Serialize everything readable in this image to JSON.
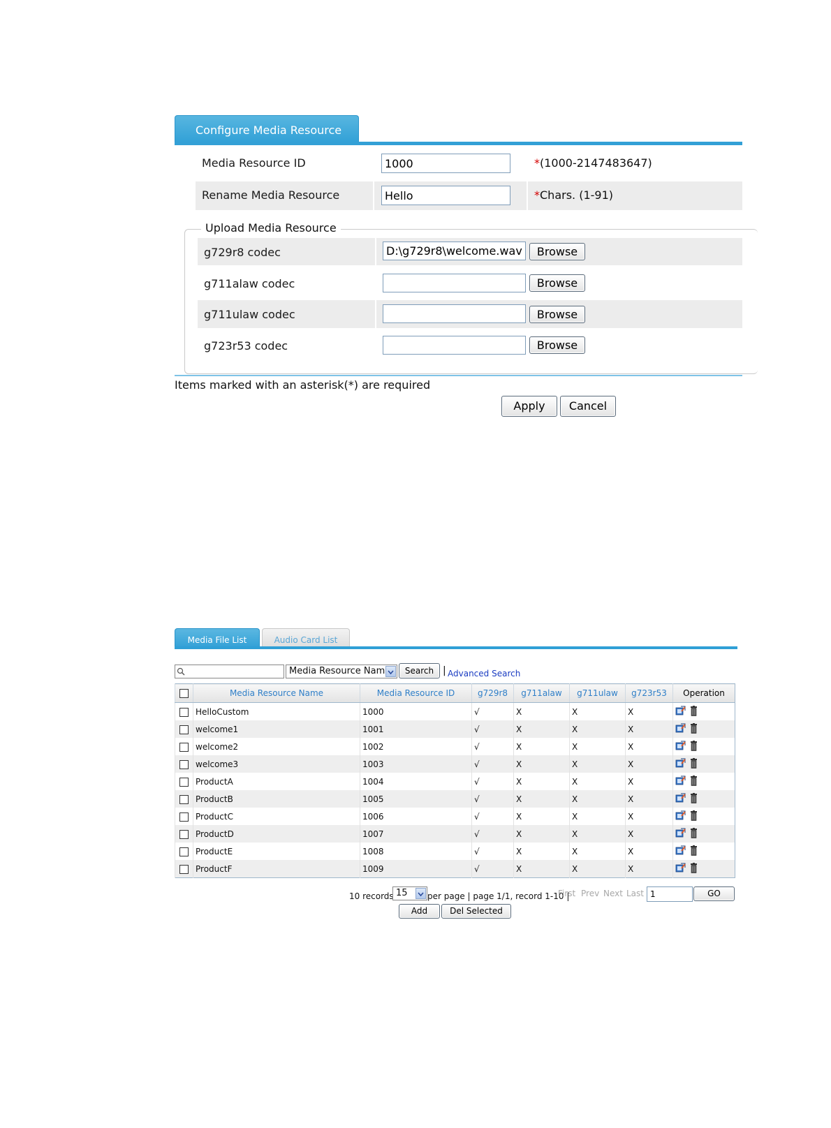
{
  "config": {
    "tab_label": "Configure Media Resource",
    "id_label": "Media Resource ID",
    "id_value": "1000",
    "id_hint_star": "*",
    "id_hint": "(1000-2147483647)",
    "rename_label": "Rename Media Resource",
    "rename_value": "Hello",
    "rename_hint_star": "*",
    "rename_hint": "Chars. (1-91)",
    "upload_legend": "Upload Media Resource",
    "codecs": [
      {
        "label": "g729r8 codec",
        "value": "D:\\g729r8\\welcome.wav",
        "browse": "Browse"
      },
      {
        "label": "g711alaw codec",
        "value": "",
        "browse": "Browse"
      },
      {
        "label": "g711ulaw codec",
        "value": "",
        "browse": "Browse"
      },
      {
        "label": "g723r53 codec",
        "value": "",
        "browse": "Browse"
      }
    ],
    "required_note": "Items marked with an asterisk(*) are required",
    "apply": "Apply",
    "cancel": "Cancel"
  },
  "list": {
    "tabs": [
      "Media File List",
      "Audio Card List"
    ],
    "search_placeholder": "",
    "search_field": "Media Resource Name",
    "search_button": "Search",
    "separator": "|",
    "advanced_search": "Advanced Search",
    "columns": [
      "Media Resource Name",
      "Media Resource ID",
      "g729r8",
      "g711alaw",
      "g711ulaw",
      "g723r53",
      "Operation"
    ],
    "rows": [
      {
        "name": "HelloCustom",
        "id": "1000",
        "g729r8": "√",
        "g711alaw": "X",
        "g711ulaw": "X",
        "g723r53": "X"
      },
      {
        "name": "welcome1",
        "id": "1001",
        "g729r8": "√",
        "g711alaw": "X",
        "g711ulaw": "X",
        "g723r53": "X"
      },
      {
        "name": "welcome2",
        "id": "1002",
        "g729r8": "√",
        "g711alaw": "X",
        "g711ulaw": "X",
        "g723r53": "X"
      },
      {
        "name": "welcome3",
        "id": "1003",
        "g729r8": "√",
        "g711alaw": "X",
        "g711ulaw": "X",
        "g723r53": "X"
      },
      {
        "name": "ProductA",
        "id": "1004",
        "g729r8": "√",
        "g711alaw": "X",
        "g711ulaw": "X",
        "g723r53": "X"
      },
      {
        "name": "ProductB",
        "id": "1005",
        "g729r8": "√",
        "g711alaw": "X",
        "g711ulaw": "X",
        "g723r53": "X"
      },
      {
        "name": "ProductC",
        "id": "1006",
        "g729r8": "√",
        "g711alaw": "X",
        "g711ulaw": "X",
        "g723r53": "X"
      },
      {
        "name": "ProductD",
        "id": "1007",
        "g729r8": "√",
        "g711alaw": "X",
        "g711ulaw": "X",
        "g723r53": "X"
      },
      {
        "name": "ProductE",
        "id": "1008",
        "g729r8": "√",
        "g711alaw": "X",
        "g711ulaw": "X",
        "g723r53": "X"
      },
      {
        "name": "ProductF",
        "id": "1009",
        "g729r8": "√",
        "g711alaw": "X",
        "g711ulaw": "X",
        "g723r53": "X"
      }
    ],
    "records_text": "10 records,",
    "per_page_value": "15",
    "per_page_text": "per page | page 1/1, record 1-10 |",
    "first": "First",
    "prev": "Prev",
    "next": "Next",
    "last": "Last",
    "page_input": "1",
    "go": "GO",
    "add": "Add",
    "del_selected": "Del Selected"
  },
  "colors": {
    "accent": "#2f9fd6",
    "link": "#1a3cc2",
    "required": "#d40000"
  }
}
